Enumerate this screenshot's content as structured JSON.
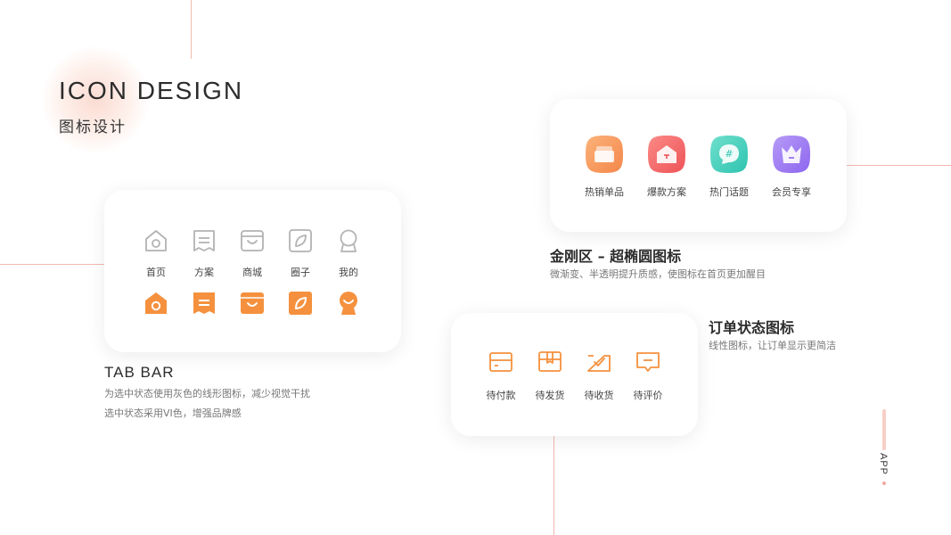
{
  "header": {
    "title_en": "ICON DESIGN",
    "title_cn": "图标设计"
  },
  "tabbar": {
    "title": "TAB BAR",
    "desc_line1": "为选中状态使用灰色的线形图标，减少视觉干扰",
    "desc_line2": "选中状态采用VI色，增强品牌感",
    "items": [
      {
        "label": "首页",
        "icon": "home-icon"
      },
      {
        "label": "方案",
        "icon": "document-icon"
      },
      {
        "label": "商城",
        "icon": "shop-bag-icon"
      },
      {
        "label": "圈子",
        "icon": "leaf-circle-icon"
      },
      {
        "label": "我的",
        "icon": "user-icon"
      }
    ],
    "active_color": "#f5913e",
    "inactive_color": "#b3b3b3"
  },
  "kingkong": {
    "title": "金刚区 – 超椭圆图标",
    "desc": "微渐变、半透明提升质感，使图标在首页更加醒目",
    "items": [
      {
        "label": "热销单品",
        "icon": "box-icon",
        "color_from": "#fbb27a",
        "color_to": "#f4874a"
      },
      {
        "label": "爆款方案",
        "icon": "house-icon",
        "color_from": "#fb8a86",
        "color_to": "#ee5358"
      },
      {
        "label": "热门话题",
        "icon": "chat-hash-icon",
        "color_from": "#6fe0cd",
        "color_to": "#2fc3b0"
      },
      {
        "label": "会员专享",
        "icon": "crown-icon",
        "color_from": "#b69af7",
        "color_to": "#8d66ee"
      }
    ]
  },
  "order": {
    "title": "订单状态图标",
    "desc": "线性图标，让订单显示更简洁",
    "items": [
      {
        "label": "待付款",
        "icon": "wallet-icon"
      },
      {
        "label": "待发货",
        "icon": "package-icon"
      },
      {
        "label": "待收货",
        "icon": "receive-box-icon"
      },
      {
        "label": "待评价",
        "icon": "comment-icon"
      }
    ],
    "color": "#f5913e"
  },
  "side": {
    "app_label": "APP"
  }
}
